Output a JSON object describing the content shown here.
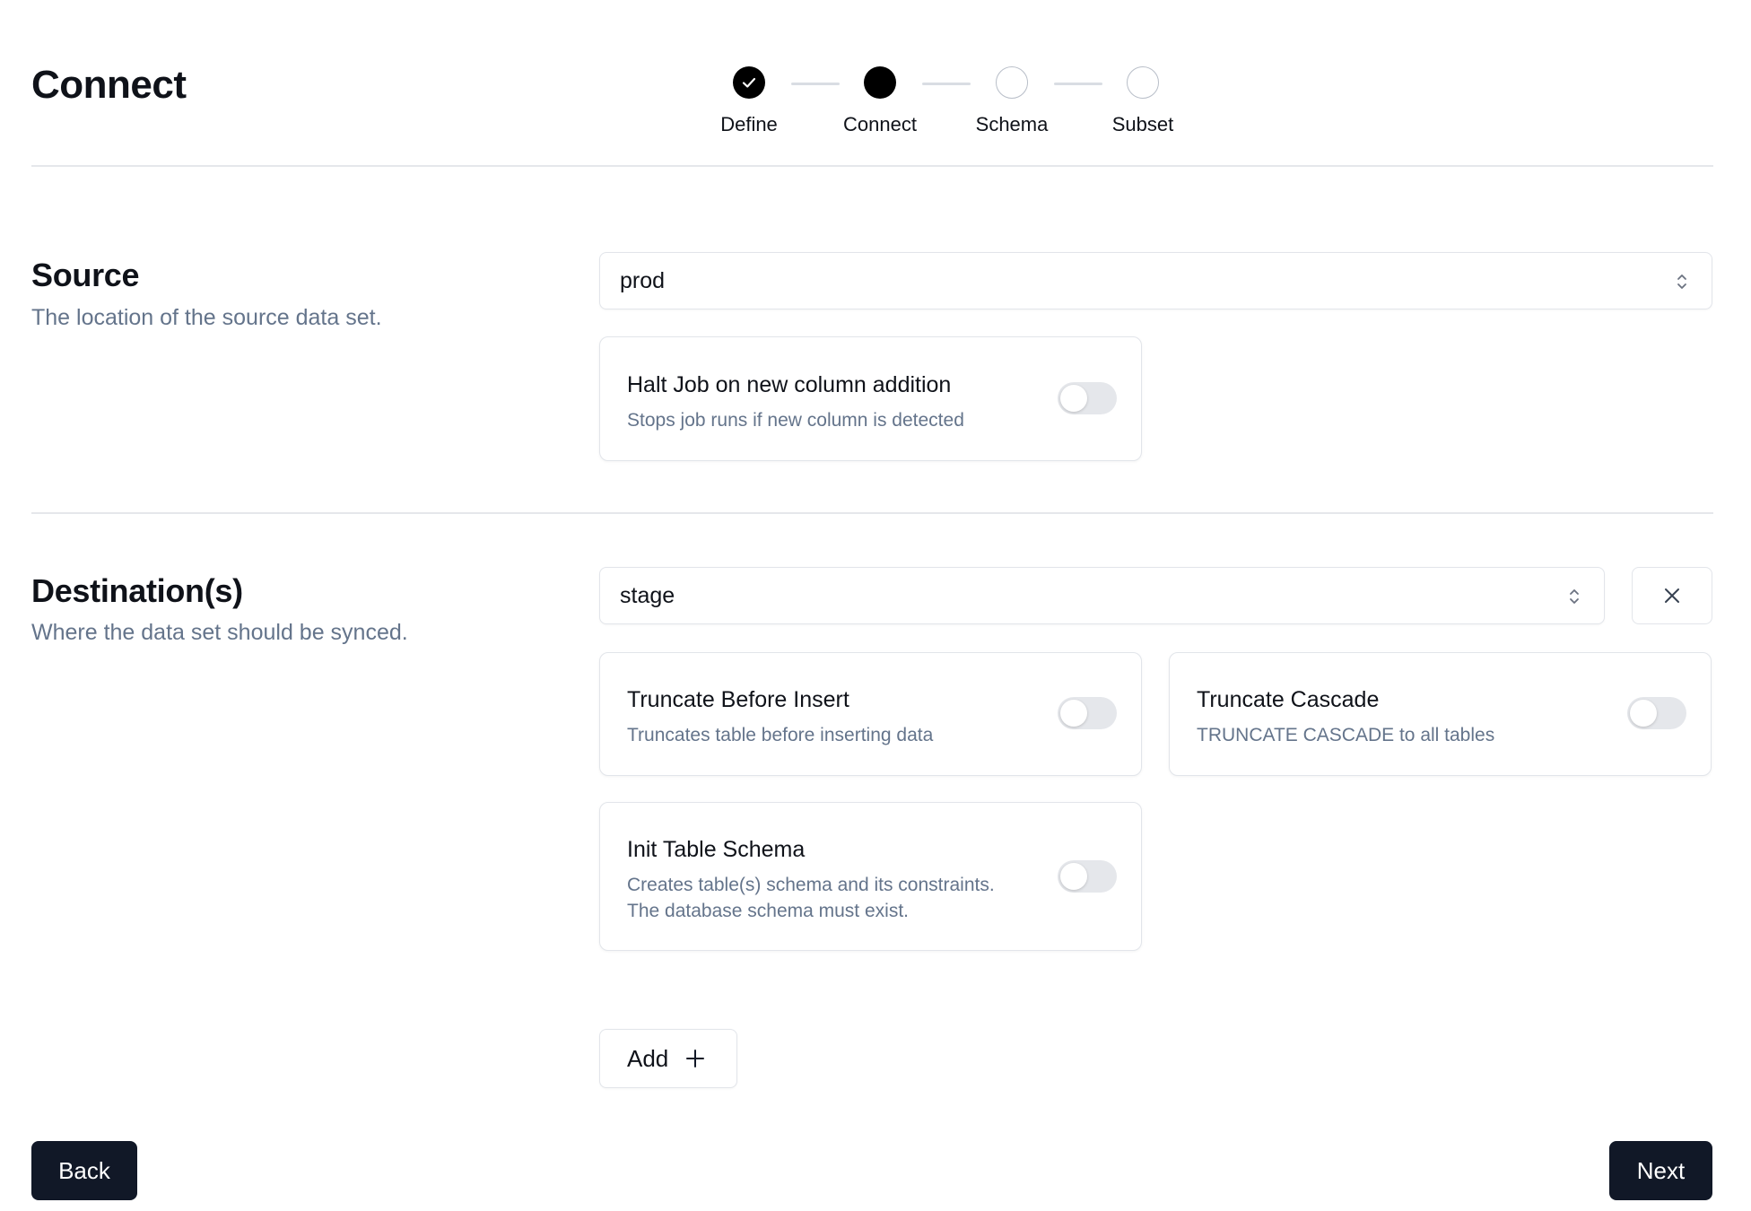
{
  "header": {
    "title": "Connect"
  },
  "stepper": {
    "steps": [
      {
        "label": "Define",
        "state": "complete"
      },
      {
        "label": "Connect",
        "state": "active"
      },
      {
        "label": "Schema",
        "state": "upcoming"
      },
      {
        "label": "Subset",
        "state": "upcoming"
      }
    ]
  },
  "source": {
    "title": "Source",
    "description": "The location of the source data set.",
    "selected_connection": "prod",
    "options": [
      {
        "title": "Halt Job on new column addition",
        "description": "Stops job runs if new column is detected",
        "enabled": false
      }
    ]
  },
  "destinations": {
    "title": "Destination(s)",
    "description": "Where the data set should be synced.",
    "items": [
      {
        "selected_connection": "stage",
        "options": [
          {
            "title": "Truncate Before Insert",
            "description": "Truncates table before inserting data",
            "enabled": false
          },
          {
            "title": "Truncate Cascade",
            "description": "TRUNCATE CASCADE to all tables",
            "enabled": false
          },
          {
            "title": "Init Table Schema",
            "description_line1": "Creates table(s) schema and its constraints.",
            "description_line2": "The database schema must exist.",
            "enabled": false
          }
        ]
      }
    ],
    "add_label": "Add"
  },
  "footer": {
    "back_label": "Back",
    "next_label": "Next"
  },
  "colors": {
    "primary": "#111827",
    "muted_text": "#64748b",
    "border": "#e2e5ea",
    "toggle_off": "#e5e7eb"
  },
  "icons": {
    "step_complete": "check-icon",
    "select": "chevron-up-down-icon",
    "remove": "close-icon",
    "add": "plus-icon"
  }
}
